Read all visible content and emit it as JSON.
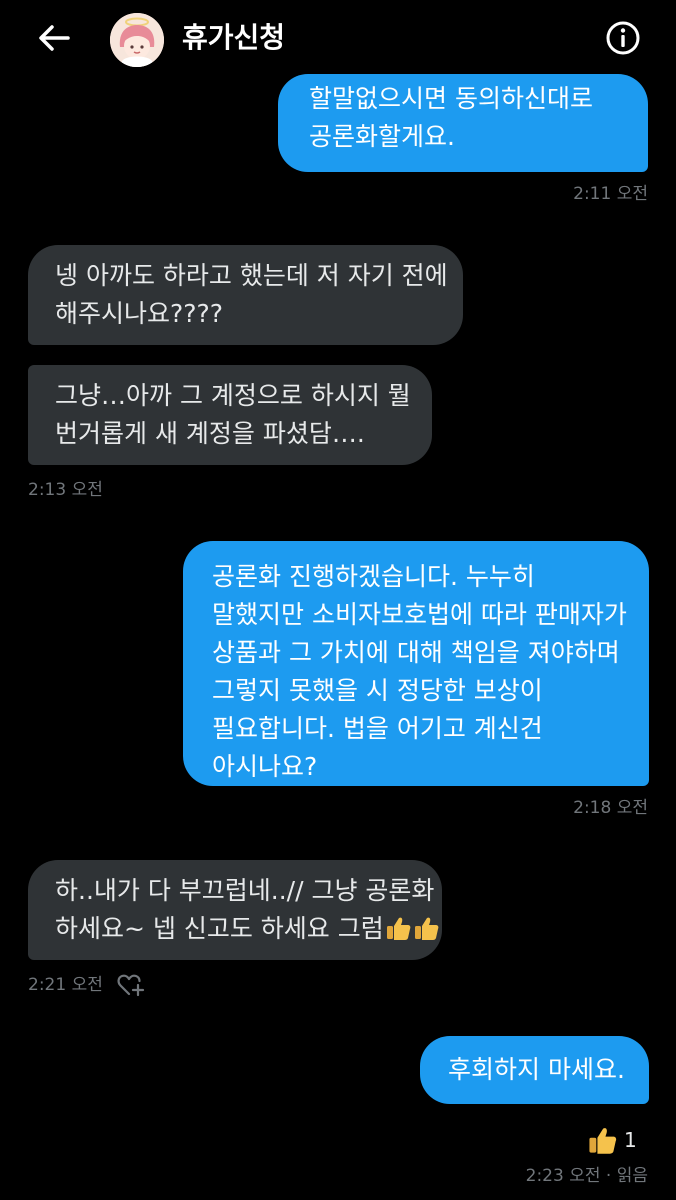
{
  "header": {
    "title": "휴가신청",
    "back_icon": "arrow-left-icon",
    "info_icon": "info-circle-icon"
  },
  "messages": [
    {
      "side": "sent",
      "lines": [
        "할말없으시면 동의하신대로",
        "공론화할게요."
      ]
    },
    {
      "side": "received",
      "lines": [
        "넹 아까도 하라고 했는데 저 자기 전에",
        "해주시나요????"
      ]
    },
    {
      "side": "received",
      "lines": [
        "그냥…아까 그 계정으로 하시지 뭘",
        "번거롭게 새 계정을 파셨담…."
      ]
    },
    {
      "side": "sent",
      "lines": [
        "공론화 진행하겠습니다. 누누히",
        "말했지만 소비자보호법에 따라 판매자가",
        "상품과 그 가치에 대해 책임을 져야하며",
        "그렇지 못했을 시 정당한 보상이",
        "필요합니다. 법을 어기고 계신건",
        "아시나요?"
      ]
    },
    {
      "side": "received",
      "lines": [
        "하..내가 다 부끄럽네..// 그냥 공론화",
        "하세요~ 넵 신고도 하세요 그럼"
      ]
    },
    {
      "side": "sent",
      "lines": [
        "후회하지 마세요."
      ]
    }
  ],
  "timestamps": {
    "t1": "2:11 오전",
    "t2": "2:13 오전",
    "t3": "2:18 오전",
    "t4": "2:21 오전",
    "t5": "2:23 오전 · 읽음"
  },
  "reaction": {
    "emoji": "thumbs-up",
    "count": "1"
  },
  "colors": {
    "background": "#000000",
    "sent_bubble": "#1d9bf0",
    "received_bubble": "#2f3336",
    "timestamp": "#71767b"
  }
}
